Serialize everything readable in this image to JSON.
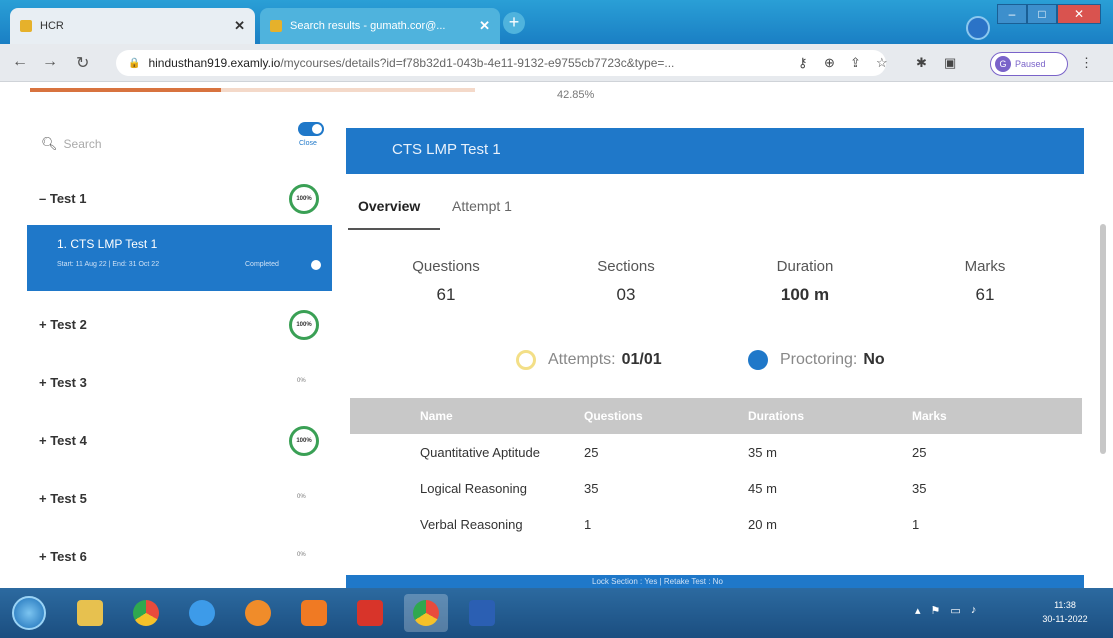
{
  "browser": {
    "tabs": [
      {
        "label": "HCR",
        "favicon_color": "#e6b12b"
      },
      {
        "label": "Search results - gumath.cor@...",
        "favicon_color": "#e6b12b"
      }
    ],
    "new_tab_icon": "plus-icon",
    "url_host": "hindusthan919.examly.io",
    "url_path": "/mycourses/details?id=f78b32d1-043b-4e11-9132-e9755cb7723c&type=...",
    "profile_initial": "G",
    "profile_status": "Paused",
    "window_buttons": [
      "–",
      "□",
      "✕"
    ]
  },
  "progress": {
    "percent_label": "42.85%",
    "value": 0.4285
  },
  "sidebar": {
    "search_placeholder": "Search",
    "toggle_label": "Close",
    "tests": [
      {
        "label": "– Test 1",
        "badge": "100%"
      },
      {
        "label": "+ Test 2",
        "badge": "100%"
      },
      {
        "label": "+ Test 3",
        "badge": "0%"
      },
      {
        "label": "+ Test 4",
        "badge": "100%"
      },
      {
        "label": "+ Test 5",
        "badge": "0%"
      },
      {
        "label": "+ Test 6",
        "badge": "0%"
      }
    ],
    "active_item": {
      "title": "1. CTS LMP Test 1",
      "subtitle": "Start: 11 Aug 22 | End: 31 Oct 22",
      "status": "Completed"
    }
  },
  "main": {
    "banner_title": "CTS LMP Test 1",
    "tabs": [
      {
        "label": "Overview"
      },
      {
        "label": "Attempt 1"
      }
    ],
    "stats": [
      {
        "label": "Questions",
        "value": "61"
      },
      {
        "label": "Sections",
        "value": "03"
      },
      {
        "label": "Duration",
        "value": "100 m"
      },
      {
        "label": "Marks",
        "value": "61"
      }
    ],
    "attempts": {
      "label": "Attempts:",
      "value": "01/01"
    },
    "proctoring": {
      "label": "Proctoring:",
      "value": "No"
    },
    "table": {
      "headers": [
        "Name",
        "Questions",
        "Durations",
        "Marks"
      ],
      "rows": [
        [
          "Quantitative Aptitude",
          "25",
          "35 m",
          "25"
        ],
        [
          "Logical Reasoning",
          "35",
          "45 m",
          "35"
        ],
        [
          "Verbal Reasoning",
          "1",
          "20 m",
          "1"
        ]
      ]
    },
    "bottom_banner": "Lock Section : Yes | Retake Test : No"
  },
  "taskbar": {
    "apps": [
      {
        "name": "file-explorer-icon",
        "color": "#e7c14f"
      },
      {
        "name": "chrome-icon",
        "color": "#e94b3c"
      },
      {
        "name": "internet-explorer-icon",
        "color": "#3d9be9"
      },
      {
        "name": "firefox-icon",
        "color": "#f08c2a"
      },
      {
        "name": "media-player-icon",
        "color": "#f07a23"
      },
      {
        "name": "wps-office-icon",
        "color": "#d8342a"
      },
      {
        "name": "chrome-active-icon",
        "color": "#e94b3c"
      },
      {
        "name": "word-icon",
        "color": "#2b5fb3"
      }
    ],
    "clock_time": "11:38",
    "clock_date": "30-11-2022"
  }
}
